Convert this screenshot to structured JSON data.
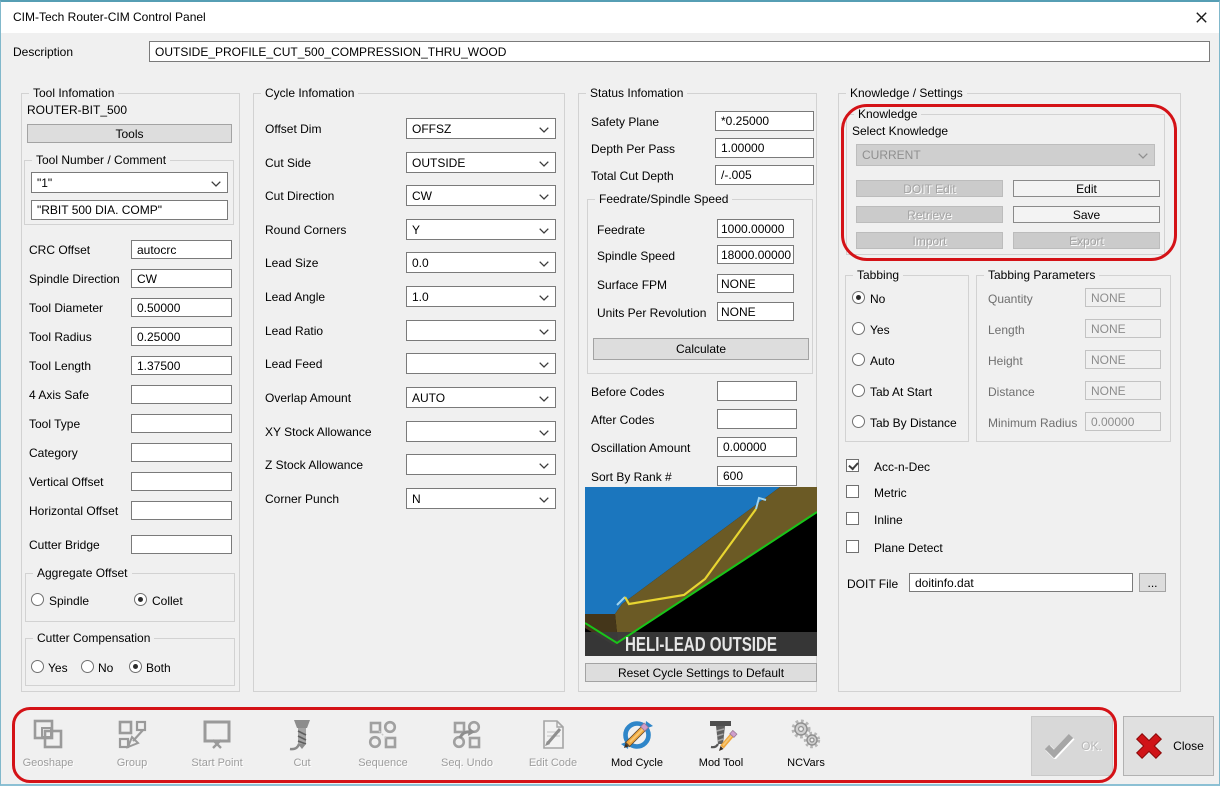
{
  "window": {
    "title": "CIM-Tech Router-CIM Control Panel"
  },
  "description": {
    "label": "Description",
    "value": "OUTSIDE_PROFILE_CUT_500_COMPRESSION_THRU_WOOD"
  },
  "tool": {
    "group_label": "Tool Infomation",
    "name": "ROUTER-BIT_500",
    "tools_button": "Tools",
    "number_group_label": "Tool Number / Comment",
    "number_value": "\"1\"",
    "comment_value": "\"RBIT 500 DIA. COMP\"",
    "fields": [
      {
        "label": "CRC Offset",
        "value": "autocrc"
      },
      {
        "label": "Spindle Direction",
        "value": "CW"
      },
      {
        "label": "Tool Diameter",
        "value": "0.50000"
      },
      {
        "label": "Tool Radius",
        "value": "0.25000"
      },
      {
        "label": "Tool Length",
        "value": "1.37500"
      },
      {
        "label": "4 Axis Safe",
        "value": ""
      },
      {
        "label": "Tool Type",
        "value": ""
      },
      {
        "label": "Category",
        "value": ""
      },
      {
        "label": "Vertical Offset",
        "value": ""
      },
      {
        "label": "Horizontal Offset",
        "value": ""
      },
      {
        "label": "Cutter Bridge",
        "value": ""
      }
    ],
    "aggregate_offset": {
      "label": "Aggregate Offset",
      "options": [
        {
          "label": "Spindle",
          "selected": false
        },
        {
          "label": "Collet",
          "selected": true
        }
      ]
    },
    "cutter_compensation": {
      "label": "Cutter Compensation",
      "options": [
        {
          "label": "Yes",
          "selected": false
        },
        {
          "label": "No",
          "selected": false
        },
        {
          "label": "Both",
          "selected": true
        }
      ]
    }
  },
  "cycle": {
    "group_label": "Cycle Infomation",
    "fields": [
      {
        "label": "Offset Dim",
        "value": "OFFSZ"
      },
      {
        "label": "Cut Side",
        "value": "OUTSIDE"
      },
      {
        "label": "Cut Direction",
        "value": "CW"
      },
      {
        "label": "Round Corners",
        "value": "Y"
      },
      {
        "label": "Lead Size",
        "value": "0.0"
      },
      {
        "label": "Lead Angle",
        "value": "1.0"
      },
      {
        "label": "Lead Ratio",
        "value": ""
      },
      {
        "label": "Lead Feed",
        "value": ""
      },
      {
        "label": "Overlap Amount",
        "value": "AUTO"
      },
      {
        "label": "XY Stock Allowance",
        "value": ""
      },
      {
        "label": "Z Stock Allowance",
        "value": ""
      },
      {
        "label": "Corner Punch",
        "value": "N"
      }
    ]
  },
  "status": {
    "group_label": "Status Infomation",
    "fields_top": [
      {
        "label": "Safety Plane",
        "value": "*0.25000"
      },
      {
        "label": "Depth Per Pass",
        "value": "1.00000"
      },
      {
        "label": "Total Cut Depth",
        "value": "/-.005"
      }
    ],
    "feedrate_group": {
      "label": "Feedrate/Spindle Speed",
      "fields": [
        {
          "label": "Feedrate",
          "value": "1000.00000"
        },
        {
          "label": "Spindle Speed",
          "value": "18000.00000"
        },
        {
          "label": "Surface FPM",
          "value": "NONE"
        },
        {
          "label": "Units Per Revolution",
          "value": "NONE"
        }
      ],
      "calculate_button": "Calculate"
    },
    "fields_bottom": [
      {
        "label": "Before Codes",
        "value": ""
      },
      {
        "label": "After Codes",
        "value": ""
      },
      {
        "label": "Oscillation Amount",
        "value": "0.00000"
      },
      {
        "label": "Sort By Rank #",
        "value": "600"
      }
    ],
    "preview_caption": "HELI-LEAD OUTSIDE",
    "reset_button": "Reset Cycle Settings to Default"
  },
  "knowledge": {
    "group_label": "Knowledge / Settings",
    "knowledge_box": {
      "label": "Knowledge",
      "select_label": "Select Knowledge",
      "combo_value": "CURRENT",
      "buttons": [
        {
          "label": "DOIT Edit",
          "enabled": false
        },
        {
          "label": "Edit",
          "enabled": true
        },
        {
          "label": "Retrieve",
          "enabled": false
        },
        {
          "label": "Save",
          "enabled": true
        },
        {
          "label": "Import",
          "enabled": false
        },
        {
          "label": "Export",
          "enabled": false
        }
      ]
    },
    "tabbing": {
      "label": "Tabbing",
      "options": [
        {
          "label": "No",
          "selected": true
        },
        {
          "label": "Yes",
          "selected": false
        },
        {
          "label": "Auto",
          "selected": false
        },
        {
          "label": "Tab At Start",
          "selected": false
        },
        {
          "label": "Tab By Distance",
          "selected": false
        }
      ]
    },
    "tabbing_parameters": {
      "label": "Tabbing Parameters",
      "fields": [
        {
          "label": "Quantity",
          "value": "NONE"
        },
        {
          "label": "Length",
          "value": "NONE"
        },
        {
          "label": "Height",
          "value": "NONE"
        },
        {
          "label": "Distance",
          "value": "NONE"
        },
        {
          "label": "Minimum Radius",
          "value": "0.00000"
        }
      ]
    },
    "checkboxes": [
      {
        "label": "Acc-n-Dec",
        "checked": true
      },
      {
        "label": "Metric",
        "checked": false
      },
      {
        "label": "Inline",
        "checked": false
      },
      {
        "label": "Plane Detect",
        "checked": false
      }
    ],
    "doit_file": {
      "label": "DOIT File",
      "value": "doitinfo.dat",
      "browse_button": "..."
    }
  },
  "toolbar": {
    "items": [
      {
        "label": "Geoshape",
        "icon": "geoshape-icon",
        "enabled": false
      },
      {
        "label": "Group",
        "icon": "group-icon",
        "enabled": false
      },
      {
        "label": "Start Point",
        "icon": "start-point-icon",
        "enabled": false
      },
      {
        "label": "Cut",
        "icon": "cut-icon",
        "enabled": false
      },
      {
        "label": "Sequence",
        "icon": "sequence-icon",
        "enabled": false
      },
      {
        "label": "Seq. Undo",
        "icon": "seq-undo-icon",
        "enabled": false
      },
      {
        "label": "Edit Code",
        "icon": "edit-code-icon",
        "enabled": false
      },
      {
        "label": "Mod Cycle",
        "icon": "mod-cycle-icon",
        "enabled": true
      },
      {
        "label": "Mod Tool",
        "icon": "mod-tool-icon",
        "enabled": true
      },
      {
        "label": "NCVars",
        "icon": "ncvars-icon",
        "enabled": true
      }
    ],
    "ok_button": "OK.",
    "close_button": "Close"
  },
  "annotations": {
    "color": "#d41217",
    "highlighted": [
      "knowledge-box",
      "bottom-toolbar"
    ]
  }
}
